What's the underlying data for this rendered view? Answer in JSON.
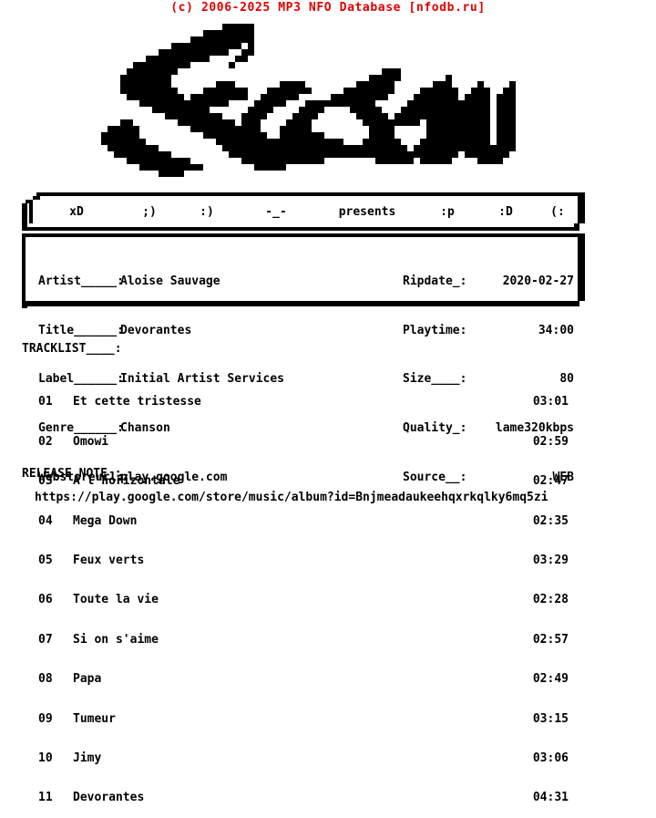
{
  "header": {
    "copyright": "(c) 2006-2025 MP3 NFO Database [nfodb.ru]",
    "color": "#e00000"
  },
  "logo": {
    "text": "Sceau",
    "style": "ascii-pixel-art",
    "color": "#000000"
  },
  "presents_bar": {
    "items": [
      "xD",
      ";)",
      ":)",
      "-_-",
      "presents",
      ":p",
      ":D",
      "(:"
    ]
  },
  "info": {
    "left": [
      {
        "key": "Artist_____:",
        "value": "Aloise Sauvage"
      },
      {
        "key": "Title______:",
        "value": "Devorantes"
      },
      {
        "key": "Label______:",
        "value": "Initial Artist Services"
      },
      {
        "key": "Genre______:",
        "value": "Chanson"
      },
      {
        "key": "Webstoreurl:",
        "value": "play.google.com"
      }
    ],
    "right": [
      {
        "key": "Ripdate_:",
        "value": "2020-02-27"
      },
      {
        "key": "Playtime:",
        "value": "34:00"
      },
      {
        "key": "Size____:",
        "value": "80"
      },
      {
        "key": "Quality_:",
        "value": "lame320kbps"
      },
      {
        "key": "Source__:",
        "value": "WEB"
      }
    ]
  },
  "tracklist": {
    "title": "TRACKLIST____:",
    "tracks": [
      {
        "num": "01",
        "name": "Et cette tristesse",
        "time": "03:01"
      },
      {
        "num": "02",
        "name": "Omowi",
        "time": "02:59"
      },
      {
        "num": "03",
        "name": "A l'horizontale",
        "time": "02:47"
      },
      {
        "num": "04",
        "name": "Mega Down",
        "time": "02:35"
      },
      {
        "num": "05",
        "name": "Feux verts",
        "time": "03:29"
      },
      {
        "num": "06",
        "name": "Toute la vie",
        "time": "02:28"
      },
      {
        "num": "07",
        "name": "Si on s'aime",
        "time": "02:57"
      },
      {
        "num": "08",
        "name": "Papa",
        "time": "02:49"
      },
      {
        "num": "09",
        "name": "Tumeur",
        "time": "03:15"
      },
      {
        "num": "10",
        "name": "Jimy",
        "time": "03:06"
      },
      {
        "num": "11",
        "name": "Devorantes",
        "time": "04:31"
      }
    ]
  },
  "release_note": {
    "label": "RELEASE NOTE_:",
    "url": "https://play.google.com/store/music/album?id=Bnjmeadaukeehqxrkqlky6mq5zi"
  }
}
